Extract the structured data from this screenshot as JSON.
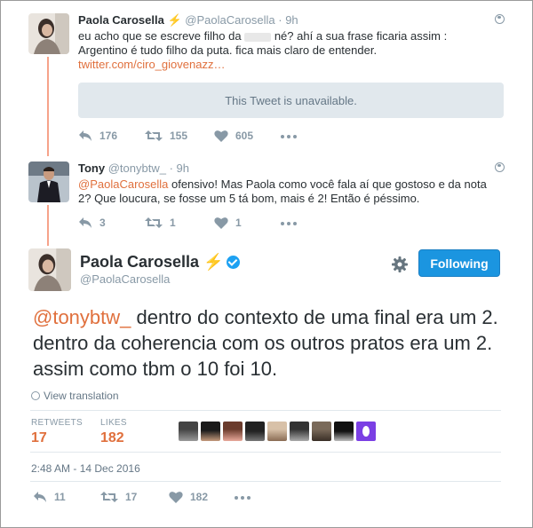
{
  "tweet1": {
    "name": "Paola Carosella",
    "badge": "⚡",
    "handle": "@PaolaCarosella",
    "time": "· 9h",
    "text_line1_a": "eu acho que se escreve filho da",
    "text_line1_b": "né? ahí a sua frase ficaria assim :",
    "text_line2": "Argentino é tudo filho da puta.  fica mais claro de entender.",
    "link": "twitter.com/ciro_giovenazz…",
    "quote_unavailable": "This Tweet is unavailable.",
    "actions": {
      "reply": "176",
      "retweet": "155",
      "like": "605"
    }
  },
  "tweet2": {
    "name": "Tony",
    "handle": "@tonybtw_",
    "time": "· 9h",
    "mention": "@PaolaCarosella",
    "text_line1": " ofensivo! Mas Paola como você fala aí que gostoso e da nota",
    "text_line2": "2? Que loucura, se fosse um 5 tá bom, mais é 2! Então é péssimo.",
    "actions": {
      "reply": "3",
      "retweet": "1",
      "like": "1"
    }
  },
  "main": {
    "name": "Paola Carosella",
    "badge": "⚡",
    "handle": "@PaolaCarosella",
    "follow_label": "Following",
    "mention": "@tonybtw_",
    "text": " dentro do contexto de uma final era um 2. dentro da coherencia com os outros pratos era um 2. assim como tbm o 10 foi 10.",
    "view_translation": "View translation",
    "retweets_label": "RETWEETS",
    "retweets": "17",
    "likes_label": "LIKES",
    "likes": "182",
    "date": "2:48 AM - 14 Dec 2016",
    "actions": {
      "reply": "11",
      "retweet": "17",
      "like": "182"
    }
  },
  "colors": {
    "accent": "#e0703d",
    "follow_blue": "#1b95e0",
    "thread_line": "#f6a38a",
    "muted": "#8899a6"
  }
}
